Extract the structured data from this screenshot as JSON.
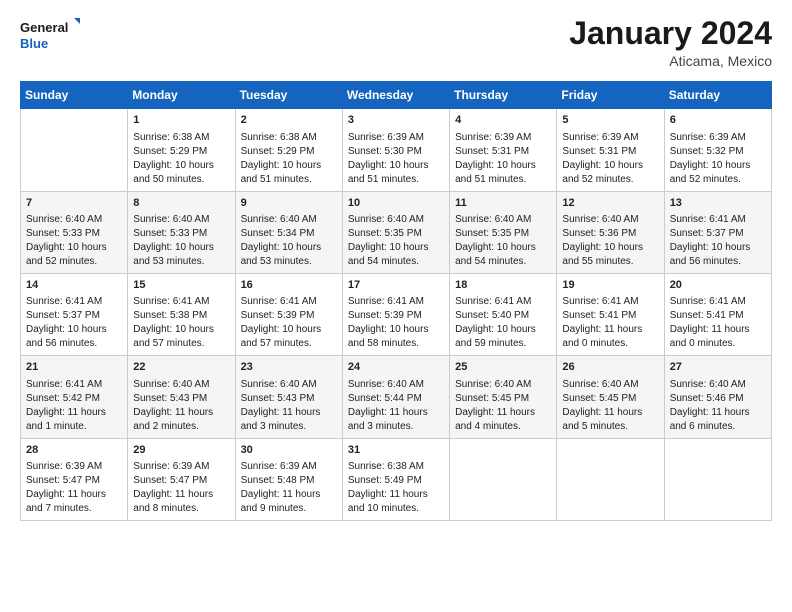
{
  "header": {
    "logo_general": "General",
    "logo_blue": "Blue",
    "month_title": "January 2024",
    "location": "Aticama, Mexico"
  },
  "days_of_week": [
    "Sunday",
    "Monday",
    "Tuesday",
    "Wednesday",
    "Thursday",
    "Friday",
    "Saturday"
  ],
  "weeks": [
    [
      {
        "day": "",
        "content": ""
      },
      {
        "day": "1",
        "content": "Sunrise: 6:38 AM\nSunset: 5:29 PM\nDaylight: 10 hours\nand 50 minutes."
      },
      {
        "day": "2",
        "content": "Sunrise: 6:38 AM\nSunset: 5:29 PM\nDaylight: 10 hours\nand 51 minutes."
      },
      {
        "day": "3",
        "content": "Sunrise: 6:39 AM\nSunset: 5:30 PM\nDaylight: 10 hours\nand 51 minutes."
      },
      {
        "day": "4",
        "content": "Sunrise: 6:39 AM\nSunset: 5:31 PM\nDaylight: 10 hours\nand 51 minutes."
      },
      {
        "day": "5",
        "content": "Sunrise: 6:39 AM\nSunset: 5:31 PM\nDaylight: 10 hours\nand 52 minutes."
      },
      {
        "day": "6",
        "content": "Sunrise: 6:39 AM\nSunset: 5:32 PM\nDaylight: 10 hours\nand 52 minutes."
      }
    ],
    [
      {
        "day": "7",
        "content": "Sunrise: 6:40 AM\nSunset: 5:33 PM\nDaylight: 10 hours\nand 52 minutes."
      },
      {
        "day": "8",
        "content": "Sunrise: 6:40 AM\nSunset: 5:33 PM\nDaylight: 10 hours\nand 53 minutes."
      },
      {
        "day": "9",
        "content": "Sunrise: 6:40 AM\nSunset: 5:34 PM\nDaylight: 10 hours\nand 53 minutes."
      },
      {
        "day": "10",
        "content": "Sunrise: 6:40 AM\nSunset: 5:35 PM\nDaylight: 10 hours\nand 54 minutes."
      },
      {
        "day": "11",
        "content": "Sunrise: 6:40 AM\nSunset: 5:35 PM\nDaylight: 10 hours\nand 54 minutes."
      },
      {
        "day": "12",
        "content": "Sunrise: 6:40 AM\nSunset: 5:36 PM\nDaylight: 10 hours\nand 55 minutes."
      },
      {
        "day": "13",
        "content": "Sunrise: 6:41 AM\nSunset: 5:37 PM\nDaylight: 10 hours\nand 56 minutes."
      }
    ],
    [
      {
        "day": "14",
        "content": "Sunrise: 6:41 AM\nSunset: 5:37 PM\nDaylight: 10 hours\nand 56 minutes."
      },
      {
        "day": "15",
        "content": "Sunrise: 6:41 AM\nSunset: 5:38 PM\nDaylight: 10 hours\nand 57 minutes."
      },
      {
        "day": "16",
        "content": "Sunrise: 6:41 AM\nSunset: 5:39 PM\nDaylight: 10 hours\nand 57 minutes."
      },
      {
        "day": "17",
        "content": "Sunrise: 6:41 AM\nSunset: 5:39 PM\nDaylight: 10 hours\nand 58 minutes."
      },
      {
        "day": "18",
        "content": "Sunrise: 6:41 AM\nSunset: 5:40 PM\nDaylight: 10 hours\nand 59 minutes."
      },
      {
        "day": "19",
        "content": "Sunrise: 6:41 AM\nSunset: 5:41 PM\nDaylight: 11 hours\nand 0 minutes."
      },
      {
        "day": "20",
        "content": "Sunrise: 6:41 AM\nSunset: 5:41 PM\nDaylight: 11 hours\nand 0 minutes."
      }
    ],
    [
      {
        "day": "21",
        "content": "Sunrise: 6:41 AM\nSunset: 5:42 PM\nDaylight: 11 hours\nand 1 minute."
      },
      {
        "day": "22",
        "content": "Sunrise: 6:40 AM\nSunset: 5:43 PM\nDaylight: 11 hours\nand 2 minutes."
      },
      {
        "day": "23",
        "content": "Sunrise: 6:40 AM\nSunset: 5:43 PM\nDaylight: 11 hours\nand 3 minutes."
      },
      {
        "day": "24",
        "content": "Sunrise: 6:40 AM\nSunset: 5:44 PM\nDaylight: 11 hours\nand 3 minutes."
      },
      {
        "day": "25",
        "content": "Sunrise: 6:40 AM\nSunset: 5:45 PM\nDaylight: 11 hours\nand 4 minutes."
      },
      {
        "day": "26",
        "content": "Sunrise: 6:40 AM\nSunset: 5:45 PM\nDaylight: 11 hours\nand 5 minutes."
      },
      {
        "day": "27",
        "content": "Sunrise: 6:40 AM\nSunset: 5:46 PM\nDaylight: 11 hours\nand 6 minutes."
      }
    ],
    [
      {
        "day": "28",
        "content": "Sunrise: 6:39 AM\nSunset: 5:47 PM\nDaylight: 11 hours\nand 7 minutes."
      },
      {
        "day": "29",
        "content": "Sunrise: 6:39 AM\nSunset: 5:47 PM\nDaylight: 11 hours\nand 8 minutes."
      },
      {
        "day": "30",
        "content": "Sunrise: 6:39 AM\nSunset: 5:48 PM\nDaylight: 11 hours\nand 9 minutes."
      },
      {
        "day": "31",
        "content": "Sunrise: 6:38 AM\nSunset: 5:49 PM\nDaylight: 11 hours\nand 10 minutes."
      },
      {
        "day": "",
        "content": ""
      },
      {
        "day": "",
        "content": ""
      },
      {
        "day": "",
        "content": ""
      }
    ]
  ]
}
